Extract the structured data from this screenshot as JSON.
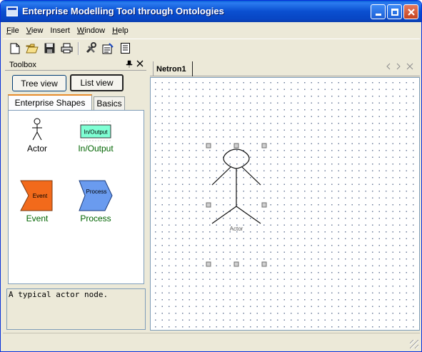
{
  "window": {
    "title": "Enterprise Modelling Tool through Ontologies",
    "controls": [
      "minimize",
      "maximize",
      "close"
    ]
  },
  "menubar": {
    "items": [
      {
        "key": "F",
        "rest": "ile"
      },
      {
        "key": "V",
        "rest": "iew"
      },
      {
        "key": "",
        "rest": "Insert"
      },
      {
        "key": "W",
        "rest": "indow"
      },
      {
        "key": "H",
        "rest": "elp"
      }
    ]
  },
  "toolbar": {
    "icons": [
      "new-file-icon",
      "open-folder-icon",
      "save-icon",
      "print-icon",
      "tools-icon",
      "properties-icon",
      "document-icon"
    ]
  },
  "toolbox": {
    "title": "Toolbox",
    "tree_view_label": "Tree view",
    "list_view_label": "List view",
    "tabs": [
      "Enterprise Shapes",
      "Basics"
    ],
    "active_tab": "Enterprise Shapes",
    "shapes": [
      {
        "label": "Actor",
        "icon": "actor-icon"
      },
      {
        "label": "In/Output",
        "icon": "inoutput-icon",
        "inner_text": "In/Output"
      },
      {
        "label": "Event",
        "icon": "event-icon",
        "inner_text": "Event"
      },
      {
        "label": "Process",
        "icon": "process-icon",
        "inner_text": "Process"
      }
    ],
    "description": "A typical actor node."
  },
  "document": {
    "tab_label": "Netron1",
    "canvas_node_label": "Actor"
  },
  "colors": {
    "titlebar": "#0a4fd0",
    "inoutput_fill": "#7fffd4",
    "event_fill": "#f26a1b",
    "process_fill": "#6a9bef",
    "green_label": "#006400"
  }
}
